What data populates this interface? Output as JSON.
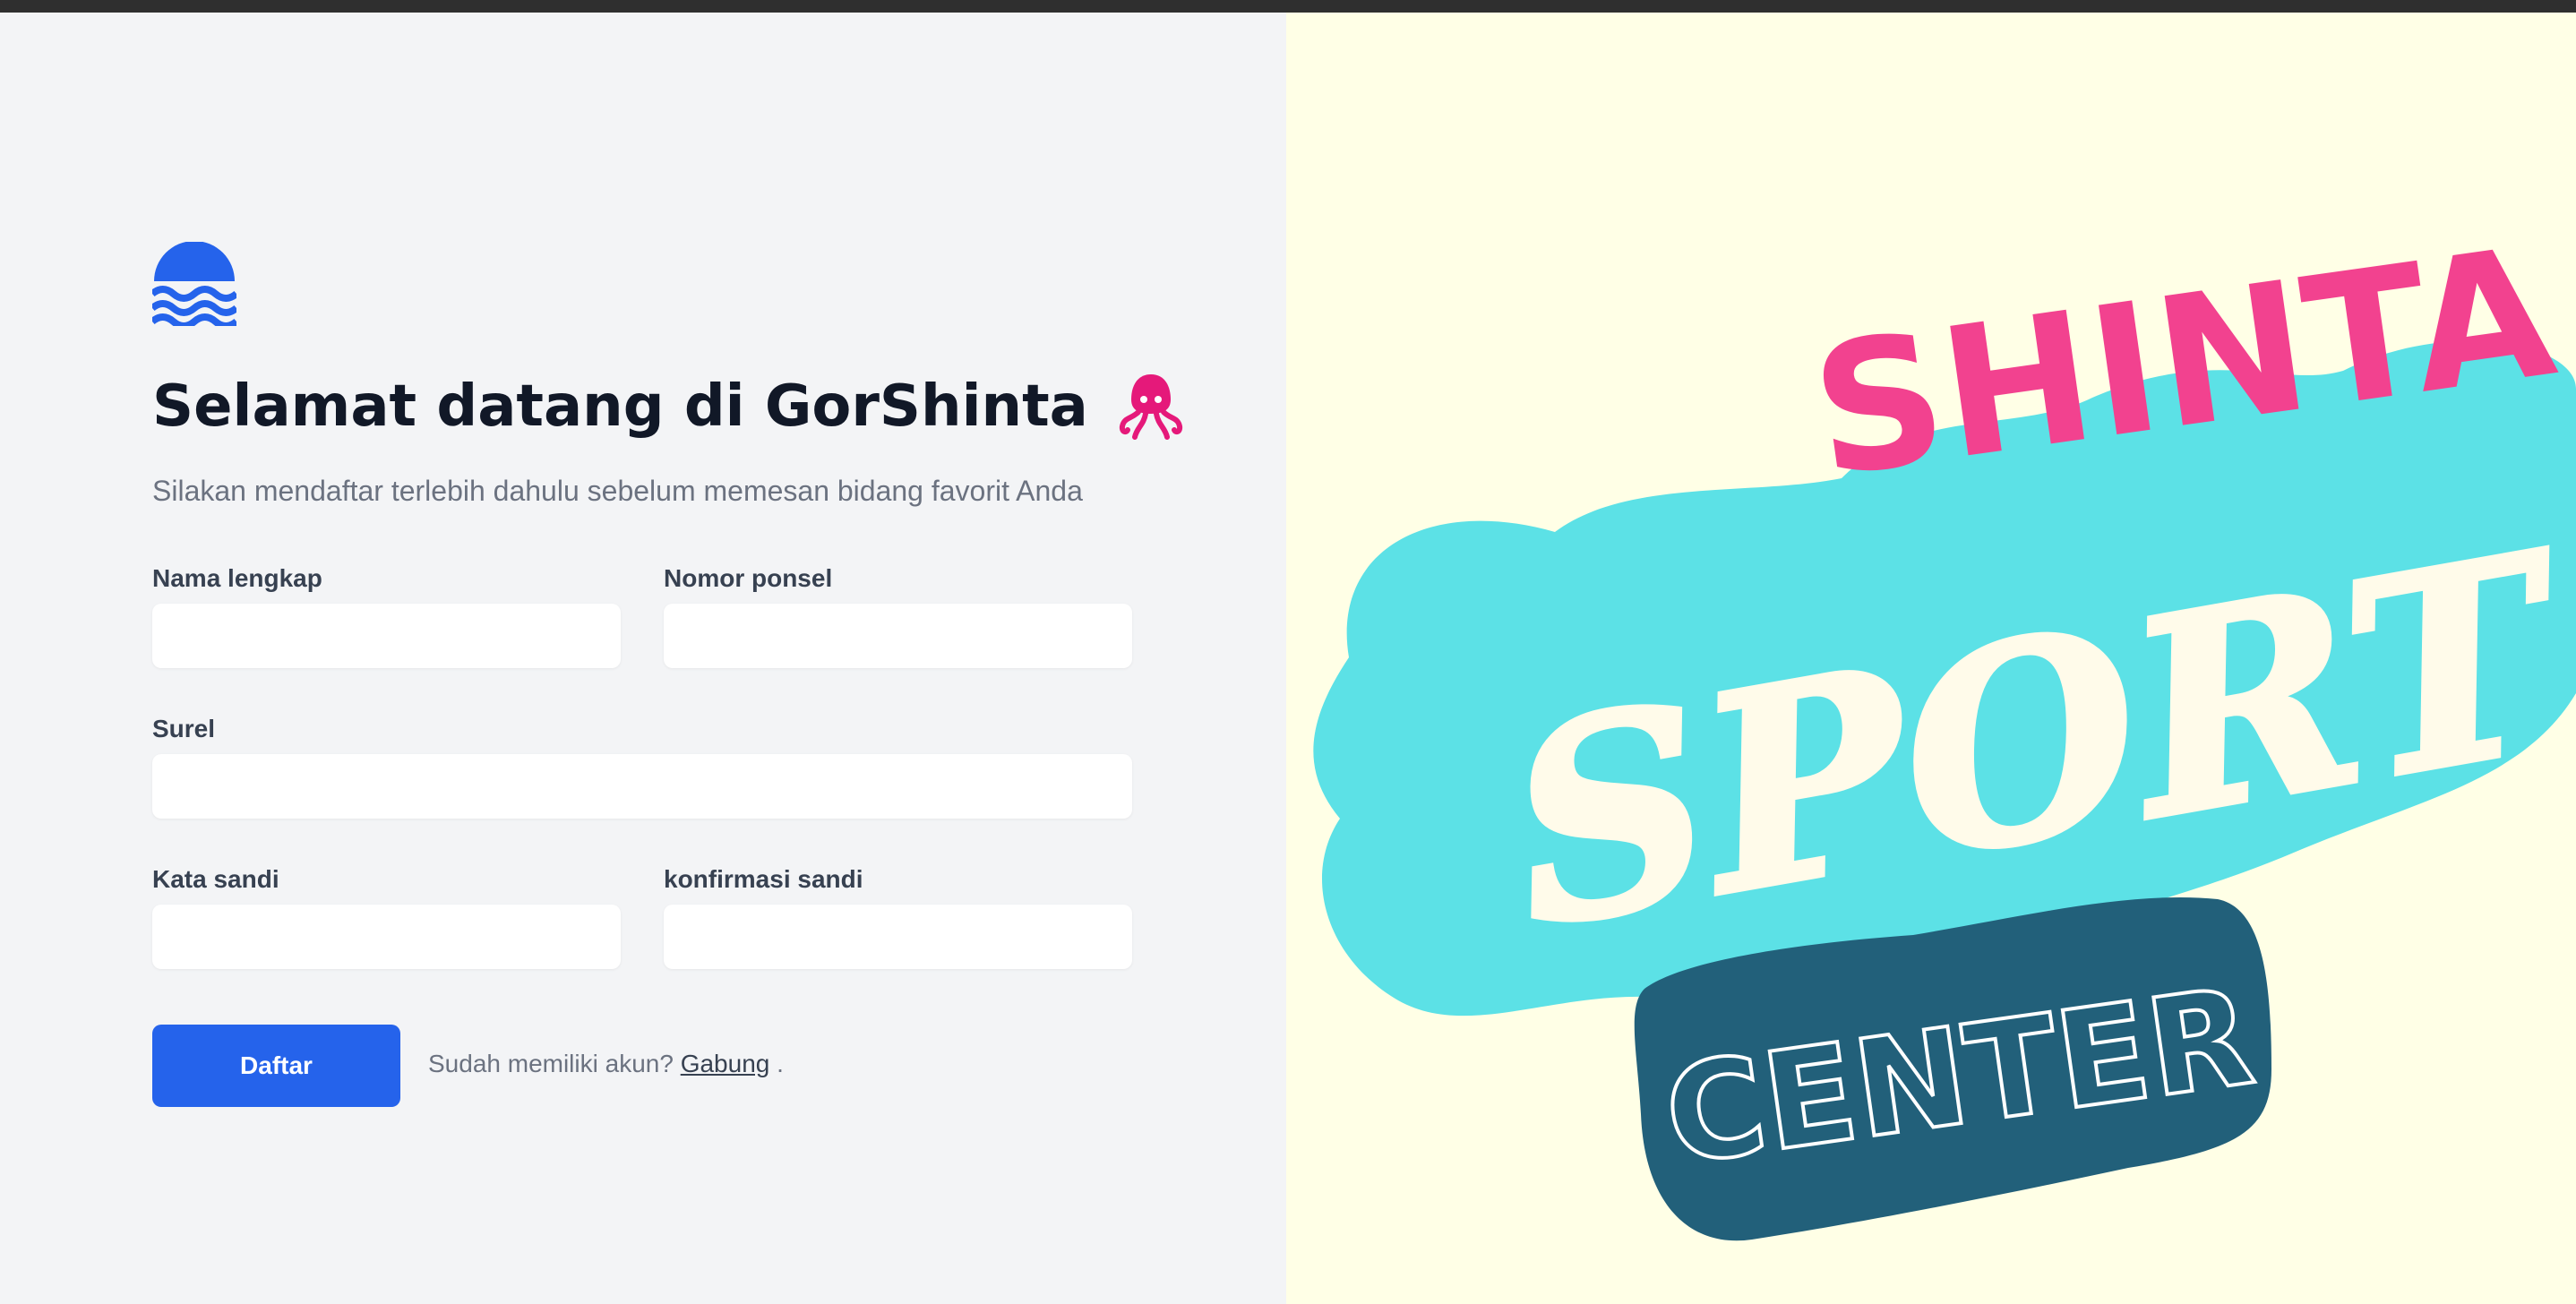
{
  "page": {
    "title": "Selamat datang di GorShinta",
    "subtitle": "Silakan mendaftar terlebih dahulu sebelum memesan bidang favorit Anda"
  },
  "form": {
    "full_name_label": "Nama lengkap",
    "phone_label": "Nomor ponsel",
    "email_label": "Surel",
    "password_label": "Kata sandi",
    "confirm_label": "konfirmasi sandi",
    "full_name_value": "",
    "phone_value": "",
    "email_value": "",
    "password_value": "",
    "confirm_value": "",
    "submit_label": "Daftar"
  },
  "login": {
    "prompt": "Sudah memiliki akun?",
    "link_label": "Gabung",
    "suffix": "."
  },
  "banner": {
    "line1": "SHINTA",
    "line2": "SPORT",
    "line3": "CENTER"
  },
  "colors": {
    "accent": "#2563eb",
    "banner_pink": "#f2428f",
    "banner_cyan": "#5ce1e6",
    "banner_navy": "#22607a",
    "banner_bg": "#ffffe6"
  },
  "icons": {
    "logo": "waves-logo-icon",
    "emoji": "squid-icon"
  }
}
